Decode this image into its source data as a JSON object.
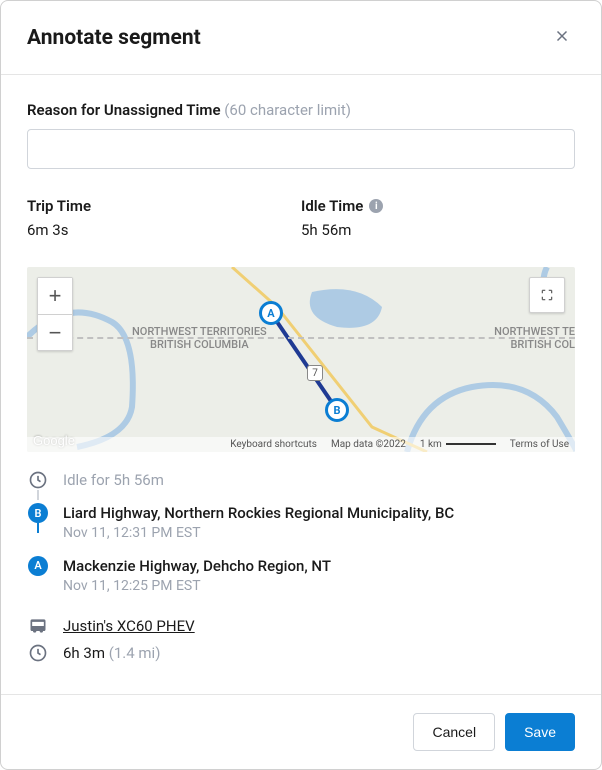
{
  "header": {
    "title": "Annotate segment"
  },
  "reason": {
    "label": "Reason for Unassigned Time",
    "limit_text": "(60 character limit)",
    "value": ""
  },
  "stats": {
    "trip": {
      "label": "Trip Time",
      "value": "6m 3s"
    },
    "idle": {
      "label": "Idle Time",
      "value": "5h 56m"
    }
  },
  "map": {
    "region1_line1": "NORTHWEST TERRITORIES",
    "region1_line2": "BRITISH COLUMBIA",
    "region2_line1": "NORTHWEST TE",
    "region2_line2": "BRITISH COL",
    "marker_a": "A",
    "marker_b": "B",
    "attrib": {
      "shortcuts": "Keyboard shortcuts",
      "data": "Map data ©2022",
      "scale": "1 km",
      "terms": "Terms of Use"
    },
    "logo": "Google",
    "route_label": "7"
  },
  "timeline": {
    "idle_text": "Idle for 5h 56m",
    "b": {
      "loc": "Liard Highway, Northern Rockies Regional Municipality, BC",
      "time": "Nov 11, 12:31 PM EST"
    },
    "a": {
      "loc": "Mackenzie Highway, Dehcho Region, NT",
      "time": "Nov 11, 12:25 PM EST"
    },
    "vehicle": "Justin's XC60 PHEV",
    "duration": "6h 3m",
    "distance": "(1.4 mi)"
  },
  "footer": {
    "cancel": "Cancel",
    "save": "Save"
  },
  "markers": {
    "a": "A",
    "b": "B"
  }
}
